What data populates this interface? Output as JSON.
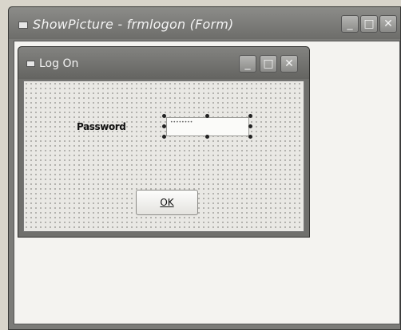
{
  "outer_window": {
    "title": "ShowPicture - frmlogon (Form)",
    "minimize_glyph": "_",
    "maximize_glyph": "□",
    "close_glyph": "✕"
  },
  "form_window": {
    "title": "Log On",
    "minimize_glyph": "_",
    "maximize_glyph": "□",
    "close_glyph": "✕"
  },
  "form": {
    "password_label": "Password",
    "password_value": "••••••••",
    "ok_label": "OK"
  },
  "colors": {
    "title_bar": "#777774",
    "client": "#f4f3f0",
    "form_grid_bg": "#e9e8e4",
    "selection_handle": "#222222"
  },
  "icons": {
    "outer_system": "window-menu-icon",
    "form_system": "window-menu-icon",
    "minimize": "minimize-icon",
    "maximize": "maximize-icon",
    "close": "close-icon"
  }
}
